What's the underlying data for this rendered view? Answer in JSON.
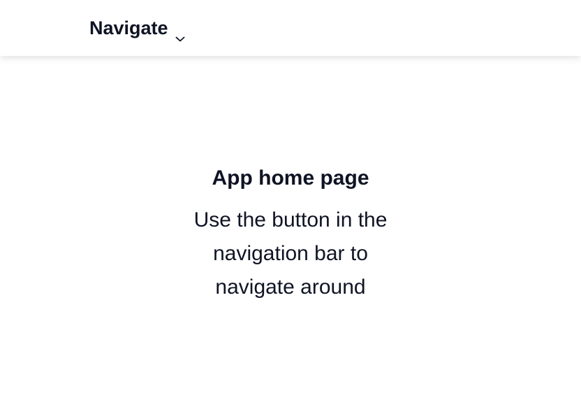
{
  "navbar": {
    "button_label": "Navigate",
    "icon": "chevron-down-icon"
  },
  "main": {
    "title": "App home page",
    "description": "Use the button in the navigation bar to navigate around"
  },
  "colors": {
    "text": "#0f1424",
    "background": "#ffffff"
  }
}
